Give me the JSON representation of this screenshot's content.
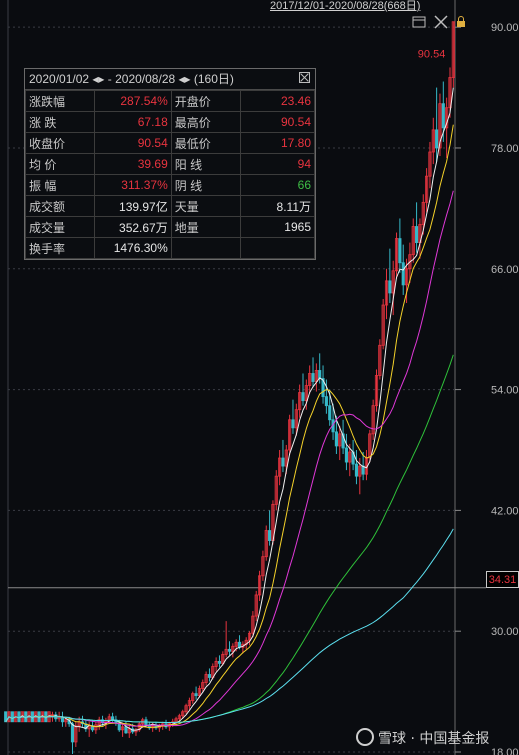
{
  "header": {
    "range_label": "2017/12/01-2020/08/28(668日)"
  },
  "stats_panel": {
    "title": "2020/01/02 ◂▸ - 2020/08/28 ◂▸ (160日)",
    "rows": [
      [
        {
          "label": "涨跌幅",
          "value": "287.54%",
          "color": "red"
        },
        {
          "label": "开盘价",
          "value": "23.46",
          "color": "red"
        }
      ],
      [
        {
          "label": "涨  跌",
          "value": "67.18",
          "color": "red"
        },
        {
          "label": "最高价",
          "value": "90.54",
          "color": "red"
        }
      ],
      [
        {
          "label": "收盘价",
          "value": "90.54",
          "color": "red"
        },
        {
          "label": "最低价",
          "value": "17.80",
          "color": "red"
        }
      ],
      [
        {
          "label": "均  价",
          "value": "39.69",
          "color": "red"
        },
        {
          "label": "阳  线",
          "value": "94",
          "color": "red"
        }
      ],
      [
        {
          "label": "振  幅",
          "value": "311.37%",
          "color": "red"
        },
        {
          "label": "阴  线",
          "value": "66",
          "color": "green"
        }
      ],
      [
        {
          "label": "成交额",
          "value": "139.97亿",
          "color": "white"
        },
        {
          "label": "天量",
          "value": "8.11万",
          "color": "white"
        }
      ],
      [
        {
          "label": "成交量",
          "value": "352.67万",
          "color": "white"
        },
        {
          "label": "地量",
          "value": "1965",
          "color": "white"
        }
      ],
      [
        {
          "label": "换手率",
          "value": "1476.30%",
          "color": "white"
        },
        {
          "label": "",
          "value": "",
          "color": "white"
        }
      ]
    ]
  },
  "current_price_label": "34.31",
  "watermark": "雪球 · 中国基金报",
  "colors": {
    "up": "#e8343f",
    "down": "#36b8c8",
    "ma5": "#f0f0f0",
    "ma10": "#f5d22a",
    "ma20": "#e038d8",
    "ma60": "#2fc23a",
    "ma120": "#5ce0f0",
    "grid": "#3a3d44",
    "axis_text": "#b8b8b8"
  },
  "chart_data": {
    "type": "candlestick",
    "title": "",
    "y_ticks": [
      18.0,
      30.0,
      42.0,
      54.0,
      66.0,
      78.0,
      90.0
    ],
    "ylim": [
      18.0,
      92.5
    ],
    "annotations": [
      {
        "label": "90.54",
        "kind": "high",
        "value": 90.54
      },
      {
        "label": "17.80",
        "kind": "low",
        "value": 17.8
      }
    ],
    "series": [
      {
        "name": "price",
        "values_ohlc": [
          [
            22,
            22,
            21,
            21
          ],
          [
            21,
            22,
            21,
            22
          ],
          [
            22,
            22,
            21,
            21
          ],
          [
            21,
            22,
            21,
            22
          ],
          [
            22,
            22,
            21,
            21
          ],
          [
            21,
            22,
            21,
            22
          ],
          [
            22,
            22,
            21,
            21
          ],
          [
            21,
            22,
            21,
            22
          ],
          [
            22,
            22,
            21,
            21
          ],
          [
            21,
            22,
            21,
            22
          ],
          [
            22,
            22,
            21,
            21
          ],
          [
            21,
            22,
            21,
            22
          ],
          [
            22,
            22,
            21,
            21
          ],
          [
            21,
            22,
            21,
            22
          ],
          [
            21.5,
            22,
            21,
            21.7
          ],
          [
            21.7,
            22,
            21,
            21.3
          ],
          [
            21.3,
            22,
            21,
            21.5
          ],
          [
            21.5,
            22,
            20.5,
            21
          ],
          [
            21,
            21.5,
            20.5,
            21.2
          ],
          [
            21.2,
            21.5,
            20.5,
            20.8
          ],
          [
            20.8,
            21,
            17.8,
            19
          ],
          [
            19,
            21,
            18.5,
            20.6
          ],
          [
            20.6,
            21.5,
            20,
            21
          ],
          [
            21,
            21.6,
            20.5,
            20.8
          ],
          [
            20.8,
            21.2,
            20,
            20.3
          ],
          [
            20.3,
            21,
            19.5,
            20.6
          ],
          [
            20.6,
            21.2,
            20,
            20.2
          ],
          [
            20.2,
            21,
            19.8,
            20.7
          ],
          [
            20.7,
            21.5,
            20.2,
            21.2
          ],
          [
            21.2,
            21.6,
            20.6,
            20.9
          ],
          [
            20.9,
            21.4,
            20.3,
            21.1
          ],
          [
            21.1,
            21.8,
            20.8,
            21.5
          ],
          [
            21.5,
            21.9,
            21,
            21.2
          ],
          [
            21.2,
            21.6,
            20.6,
            20.9
          ],
          [
            20.9,
            21.2,
            20,
            20.2
          ],
          [
            20.2,
            20.8,
            19.5,
            20.5
          ],
          [
            20.5,
            21,
            19.8,
            19.9
          ],
          [
            19.9,
            20.6,
            19.4,
            20.3
          ],
          [
            20.3,
            20.8,
            19.8,
            20
          ],
          [
            20,
            20.4,
            19.6,
            20.2
          ],
          [
            20.2,
            21,
            20,
            20.8
          ],
          [
            20.8,
            21.4,
            20.4,
            21.2
          ],
          [
            21.2,
            21.5,
            20.6,
            20.7
          ],
          [
            20.7,
            21,
            20.2,
            20.4
          ],
          [
            20.4,
            20.9,
            20,
            20.7
          ],
          [
            20.7,
            21,
            20.2,
            20.4
          ],
          [
            20.4,
            20.8,
            20,
            20.6
          ],
          [
            20.6,
            21,
            20.2,
            20.8
          ],
          [
            20.8,
            21.2,
            20.3,
            20.5
          ],
          [
            20.5,
            21,
            20.1,
            20.9
          ],
          [
            20.9,
            21.3,
            20.5,
            21
          ],
          [
            21,
            21.5,
            20.6,
            21.3
          ],
          [
            21.3,
            21.8,
            21,
            21.6
          ],
          [
            21.6,
            22.2,
            21.3,
            22
          ],
          [
            22,
            22.8,
            21.8,
            22.6
          ],
          [
            22.6,
            23.4,
            22.2,
            23.1
          ],
          [
            23.1,
            24,
            22.8,
            23.8
          ],
          [
            23.8,
            24.5,
            23.2,
            23.6
          ],
          [
            23.6,
            24.6,
            23.4,
            24.3
          ],
          [
            24.3,
            25.2,
            24,
            24.9
          ],
          [
            24.9,
            26,
            24.6,
            25.7
          ],
          [
            25.7,
            26.3,
            25,
            25.4
          ],
          [
            25.4,
            26.8,
            25.2,
            26.5
          ],
          [
            26.5,
            27.4,
            26,
            27
          ],
          [
            27,
            27.6,
            26.4,
            26.8
          ],
          [
            26.8,
            28,
            26.6,
            27.7
          ],
          [
            27.7,
            31,
            27.4,
            28.2
          ],
          [
            28.2,
            29,
            27.6,
            28
          ],
          [
            28,
            28.8,
            27.4,
            28.5
          ],
          [
            28.5,
            29.2,
            28,
            28.9
          ],
          [
            28.9,
            29.6,
            28.2,
            28.4
          ],
          [
            28.4,
            29,
            27.8,
            28.7
          ],
          [
            28.7,
            29.4,
            28.2,
            29.1
          ],
          [
            29.1,
            30,
            28.6,
            29.8
          ],
          [
            29.8,
            32,
            29.4,
            31.5
          ],
          [
            31.5,
            34,
            31,
            33.6
          ],
          [
            33.6,
            36,
            33,
            35.5
          ],
          [
            35.5,
            38,
            35,
            37.4
          ],
          [
            37.4,
            40.5,
            37,
            40
          ],
          [
            40,
            42,
            38.5,
            39
          ],
          [
            39,
            43,
            38.6,
            42.6
          ],
          [
            42.6,
            46,
            42,
            45.4
          ],
          [
            45.4,
            48,
            44.5,
            47.2
          ],
          [
            47.2,
            49,
            45.8,
            46.4
          ],
          [
            46.4,
            48.5,
            45.6,
            48
          ],
          [
            48,
            51.5,
            47.5,
            51
          ],
          [
            51,
            53,
            49.6,
            50.2
          ],
          [
            50.2,
            52.6,
            49.4,
            52
          ],
          [
            52,
            54.5,
            51.2,
            53.7
          ],
          [
            53.7,
            55.6,
            52.4,
            52.9
          ],
          [
            52.9,
            55,
            52,
            54.4
          ],
          [
            54.4,
            56.4,
            53.6,
            55.6
          ],
          [
            55.6,
            57.2,
            54.2,
            54.8
          ],
          [
            54.8,
            56.6,
            53.8,
            55.9
          ],
          [
            55.9,
            57.6,
            54.6,
            55.1
          ],
          [
            55.1,
            56.4,
            52.6,
            53.3
          ],
          [
            53.3,
            55,
            51.6,
            52.4
          ],
          [
            52.4,
            54,
            50.4,
            51
          ],
          [
            51,
            52.6,
            49,
            49.8
          ],
          [
            49.8,
            51.4,
            47.6,
            48.4
          ],
          [
            48.4,
            50.4,
            47,
            49.6
          ],
          [
            49.6,
            51,
            47.6,
            48.2
          ],
          [
            48.2,
            49.6,
            46,
            46.8
          ],
          [
            46.8,
            48.6,
            45.4,
            47.8
          ],
          [
            47.8,
            49,
            46,
            46.6
          ],
          [
            46.6,
            48,
            44.6,
            45.4
          ],
          [
            45.4,
            47.2,
            43.6,
            46.4
          ],
          [
            46.4,
            47.8,
            45,
            45.6
          ],
          [
            45.6,
            48,
            45,
            47.2
          ],
          [
            47.2,
            50,
            46.8,
            49.6
          ],
          [
            49.6,
            53,
            49,
            52.4
          ],
          [
            52.4,
            56,
            51.8,
            55.4
          ],
          [
            55.4,
            59,
            55,
            58.4
          ],
          [
            58.4,
            63,
            58,
            62.4
          ],
          [
            62.4,
            66,
            61,
            64.8
          ],
          [
            64.8,
            68,
            62.6,
            63.6
          ],
          [
            63.6,
            66.8,
            61.4,
            65.8
          ],
          [
            65.8,
            69.6,
            65,
            69
          ],
          [
            69,
            71,
            65.6,
            66.6
          ],
          [
            66.6,
            68.4,
            63.4,
            64.4
          ],
          [
            64.4,
            67,
            62.6,
            66
          ],
          [
            66,
            68.6,
            64.6,
            67.4
          ],
          [
            67.4,
            71,
            66.6,
            70.2
          ],
          [
            70.2,
            72.6,
            67.6,
            68.6
          ],
          [
            68.6,
            71,
            67,
            70.4
          ],
          [
            70.4,
            73.4,
            69.4,
            72.6
          ],
          [
            72.6,
            76,
            71.6,
            75.2
          ],
          [
            75.2,
            78.6,
            74,
            77.6
          ],
          [
            77.6,
            81,
            76.4,
            79.8
          ],
          [
            79.8,
            84,
            76.6,
            78
          ],
          [
            78,
            83.4,
            77.2,
            82.4
          ],
          [
            82.4,
            84.6,
            78.6,
            80
          ],
          [
            80,
            83,
            77,
            82
          ],
          [
            82,
            86,
            81,
            85
          ],
          [
            85,
            90.54,
            84,
            90.54
          ]
        ]
      }
    ]
  }
}
